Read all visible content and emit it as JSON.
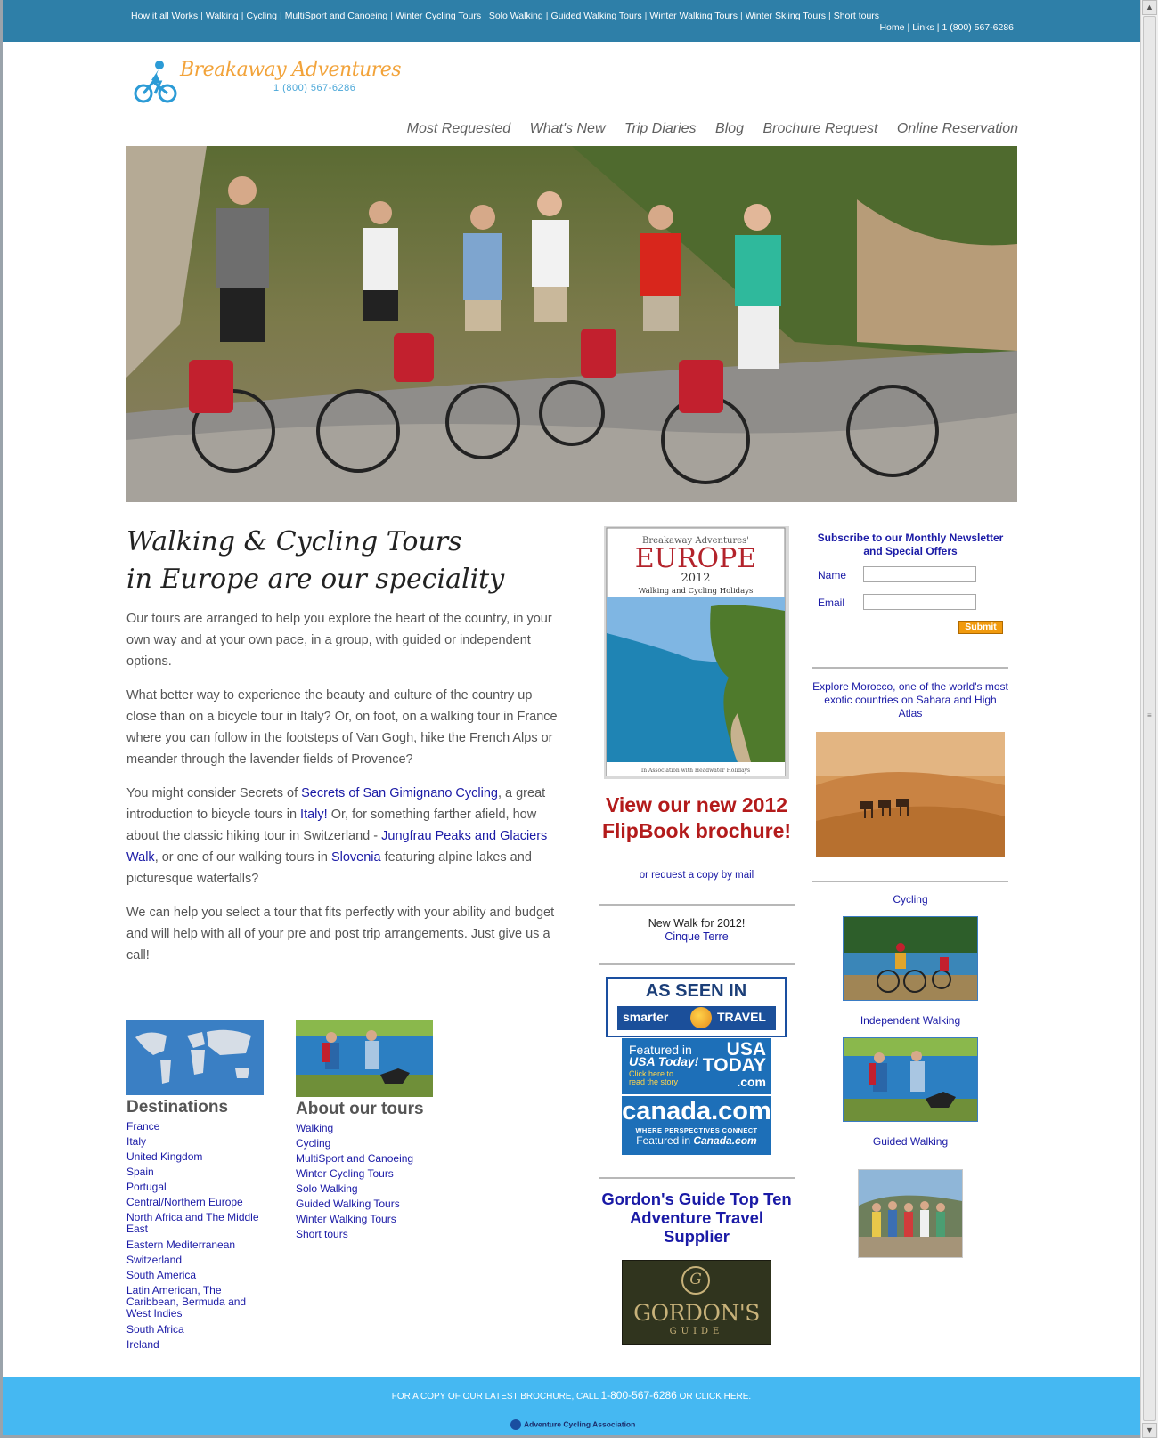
{
  "topbar": {
    "links": [
      "How it all Works",
      "Walking",
      "Cycling",
      "MultiSport and Canoeing",
      "Winter Cycling Tours",
      "Solo Walking",
      "Guided Walking Tours",
      "Winter Walking Tours",
      "Winter Skiing Tours",
      "Short tours"
    ],
    "right": [
      "Home",
      "Links",
      "1 (800) 567-6286"
    ],
    "color": "#2e7fa8"
  },
  "logo": {
    "name": "Breakaway Adventures",
    "phone": "1 (800) 567-6286",
    "icon": "cyclist-icon"
  },
  "mainnav": [
    "Most Requested",
    "What's New",
    "Trip Diaries",
    "Blog",
    "Brochure Request",
    "Online Reservation"
  ],
  "hero": {
    "icon": "hero-photo"
  },
  "headline": {
    "line1": "Walking & Cycling Tours",
    "line2": "in Europe are our speciality"
  },
  "intro": {
    "p1": "Our tours are arranged to help you explore the heart of the country, in your own way and at your own pace, in a group, with guided or independent options.",
    "p2": "What better way to experience the beauty and culture of the country up close than on a bicycle tour in Italy? Or, on foot, on a walking tour in France where you can follow in the footsteps of Van Gogh, hike the French Alps or meander through the lavender fields of Provence?",
    "p3a": "You might consider Secrets of ",
    "p3_link1": "Secrets of San Gimignano Cycling",
    "p3b": ", a great introduction to bicycle tours in ",
    "p3_link2": "Italy!",
    "p3c": " Or, for something farther afield, how about the classic hiking tour in Switzerland - ",
    "p3_link3": "Jungfrau Peaks and Glaciers Walk",
    "p3d": ", or one of our walking tours in ",
    "p3_link4": "Slovenia",
    "p3e": " featuring alpine lakes and picturesque waterfalls?",
    "p4": "We can help you select a tour that fits perfectly with your ability and budget and will help with all of your pre and post trip arrangements. Just give us a call!"
  },
  "destinations": {
    "title": "Destinations",
    "items": [
      "France",
      "Italy",
      "United Kingdom",
      "Spain",
      "Portugal",
      "Central/Northern Europe",
      "North Africa and The Middle East",
      "Eastern Mediterranean",
      "Switzerland",
      "South America",
      "Latin American, The Caribbean, Bermuda and West Indies",
      "South Africa",
      "Ireland"
    ]
  },
  "about": {
    "title": "About our tours",
    "items": [
      "Walking",
      "Cycling",
      "MultiSport and Canoeing",
      "Winter Cycling Tours",
      "Solo Walking",
      "Guided Walking Tours",
      "Winter Walking Tours",
      "Short tours"
    ]
  },
  "brochure": {
    "top": "Breakaway Adventures'",
    "europe": "EUROPE",
    "year": "2012",
    "sub": "Walking and Cycling Holidays",
    "bottom": "In Association with Headwater Holidays"
  },
  "flipbook": {
    "title": "View our new 2012 FlipBook brochure!",
    "sub": "or request a copy by mail"
  },
  "newwalk": {
    "text": "New Walk for 2012!",
    "link": "Cinque Terre"
  },
  "seen": {
    "title": "AS SEEN IN",
    "left": "smarter",
    "right": "TRAVEL"
  },
  "usa": {
    "featured": "Featured in",
    "usa_today": "USA Today!",
    "click": "Click here to",
    "click2": "read the story",
    "logo1": "USA",
    "logo2": "TODAY",
    "logo3": ".com"
  },
  "canada": {
    "logo": "canada.com",
    "tag": "WHERE PERSPECTIVES CONNECT",
    "featured": "Featured in",
    "featured_name": "Canada.com"
  },
  "gordon": {
    "title": "Gordon's Guide Top Ten Adventure Travel Supplier",
    "g": "G",
    "name": "GORDON'S",
    "guide": "GUIDE"
  },
  "newsletter": {
    "title": "Subscribe to our Monthly Newsletter and Special Offers",
    "name_label": "Name",
    "email_label": "Email",
    "submit": "Submit",
    "submit_color": "#f19a0e"
  },
  "morocco": {
    "text": "Explore Morocco, one of the world's most exotic countries on Sahara and High Atlas"
  },
  "side": {
    "cycling": "Cycling",
    "independent": "Independent Walking",
    "guided": "Guided Walking"
  },
  "footer": {
    "pre": "FOR A COPY OF OUR LATEST BROCHURE, CALL ",
    "phone": "1-800-567-6286",
    "post": " OR CLICK HERE.",
    "aca": "Adventure Cycling Association",
    "color": "#45b8f2"
  }
}
